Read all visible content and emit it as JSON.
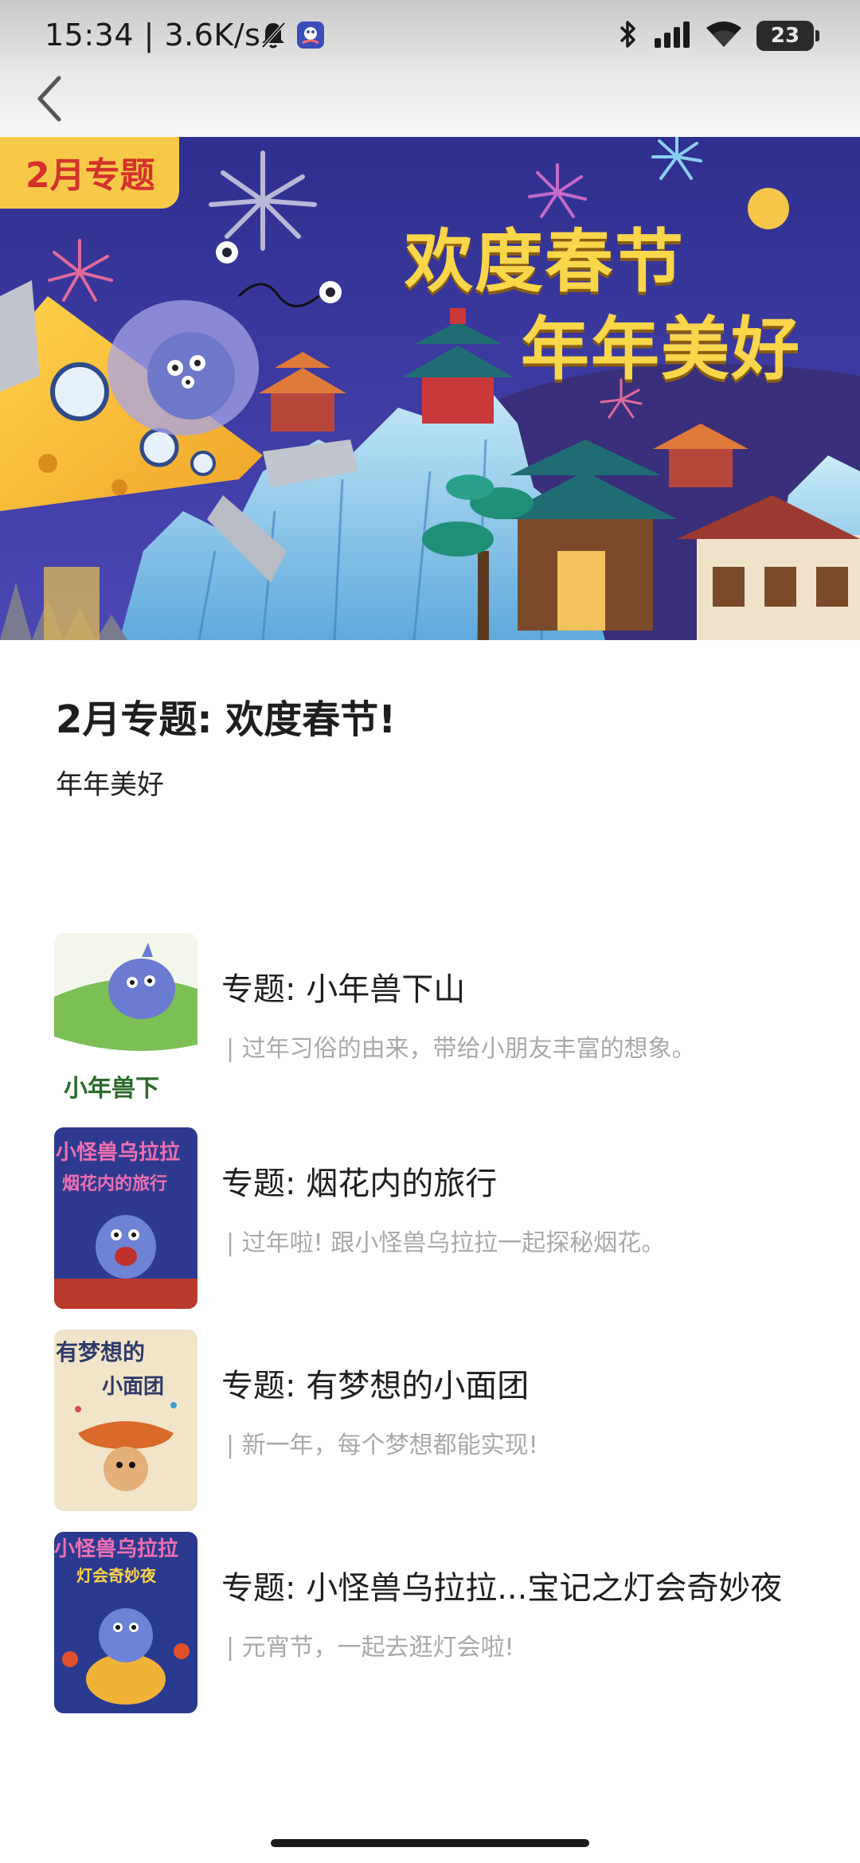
{
  "status_bar": {
    "time": "15:34 | 3.6K/s",
    "battery": "23",
    "icons": [
      "mute-bell-icon",
      "app-notification-icon",
      "bluetooth-icon",
      "signal-icon",
      "wifi-icon",
      "battery-icon"
    ]
  },
  "nav": {
    "back_icon": "chevron-left-icon"
  },
  "banner": {
    "tag": "2月专题",
    "title": "欢度春节",
    "subtitle": "年年美好",
    "colors": {
      "sky": "#3d3fa4",
      "mountain": "#7ec3e6",
      "text": "#f9d64a",
      "tag_bg": "#f7c948",
      "tag_text": "#d4312c"
    }
  },
  "header": {
    "title": "2月专题: 欢度春节!",
    "subtitle": "年年美好"
  },
  "topics": [
    {
      "title": "专题: 小年兽下山",
      "desc": "| 过年习俗的由来，带给小朋友丰富的想象。",
      "thumb_text": "小年兽下"
    },
    {
      "title": "专题: 烟花内的旅行",
      "desc": "| 过年啦! 跟小怪兽乌拉拉一起探秘烟花。",
      "thumb_text": "小怪兽乌拉拉",
      "thumb_text2": "烟花内的旅行"
    },
    {
      "title": "专题: 有梦想的小面团",
      "desc": "| 新一年，每个梦想都能实现!",
      "thumb_text": "有梦想的",
      "thumb_text2": "小面团"
    },
    {
      "title": "专题: 小怪兽乌拉拉...宝记之灯会奇妙夜",
      "desc": "| 元宵节，一起去逛灯会啦!",
      "thumb_text": "小怪兽乌拉拉",
      "thumb_text2": "灯会奇妙夜"
    }
  ]
}
